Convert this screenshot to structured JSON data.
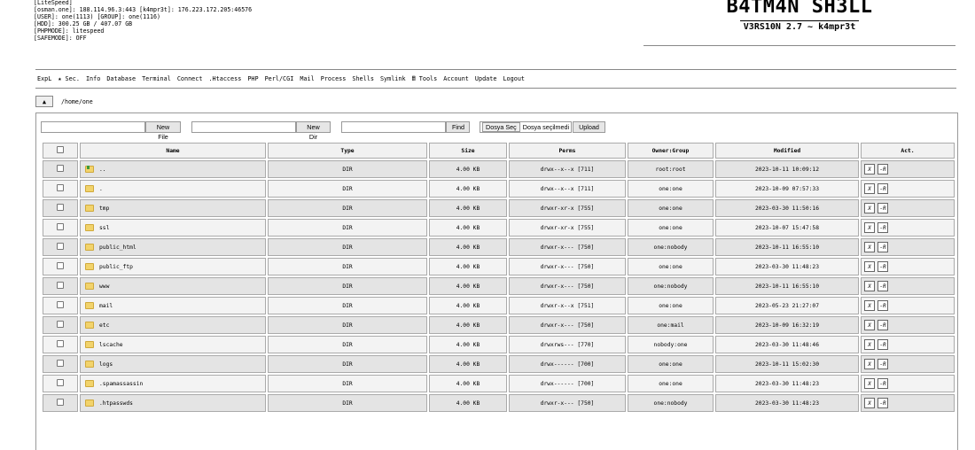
{
  "server_info": {
    "lines": [
      "[LiteSpeed]",
      "[osman.one]: 188.114.96.3:443 [k4mpr3t]: 176.223.172.205:46576",
      "[USER]: one(1113) [GROUP]: one(1116)",
      "[HDD]: 300.25 GB / 407.07 GB",
      "[PHPMODE]: litespeed",
      "[SAFEMODE]: OFF"
    ]
  },
  "brand": {
    "title": "B4TM4N SH3LL",
    "subtitle": "V3RS10N 2.7 ~ k4mpr3t"
  },
  "menu": [
    "ExpL",
    "★ Sec.",
    "Info",
    "Database",
    "Terminal",
    "Connect",
    ".Htaccess",
    "PHP",
    "Perl/CGI",
    "Mail",
    "Process",
    "Shells",
    "Symlink",
    "🖩 Tools",
    "Account",
    "Update",
    "Logout"
  ],
  "path": {
    "up_icon": "▲",
    "current": "/home/one"
  },
  "controls": {
    "new_file": "New File",
    "new_dir": "New Dir",
    "find": "Find",
    "choose_file": "Dosya Seç",
    "no_file": "Dosya seçilmedi",
    "upload": "Upload"
  },
  "table": {
    "headers": [
      "Name",
      "Type",
      "Size",
      "Perms",
      "Owner:Group",
      "Modified",
      "Act."
    ],
    "rows": [
      {
        "name": "..",
        "type": "DIR",
        "size": "4.00 KB",
        "perms": "drwx--x--x [711]",
        "owner": "root:root",
        "modified": "2023-10-11 10:09:12",
        "up": true
      },
      {
        "name": ".",
        "type": "DIR",
        "size": "4.00 KB",
        "perms": "drwx--x--x [711]",
        "owner": "one:one",
        "modified": "2023-10-09 07:57:33"
      },
      {
        "name": "tmp",
        "type": "DIR",
        "size": "4.00 KB",
        "perms": "drwxr-xr-x [755]",
        "owner": "one:one",
        "modified": "2023-03-30 11:50:16"
      },
      {
        "name": "ssl",
        "type": "DIR",
        "size": "4.00 KB",
        "perms": "drwxr-xr-x [755]",
        "owner": "one:one",
        "modified": "2023-10-07 15:47:58"
      },
      {
        "name": "public_html",
        "type": "DIR",
        "size": "4.00 KB",
        "perms": "drwxr-x--- [750]",
        "owner": "one:nobody",
        "modified": "2023-10-11 16:55:10"
      },
      {
        "name": "public_ftp",
        "type": "DIR",
        "size": "4.00 KB",
        "perms": "drwxr-x--- [750]",
        "owner": "one:one",
        "modified": "2023-03-30 11:48:23"
      },
      {
        "name": "www",
        "type": "DIR",
        "size": "4.00 KB",
        "perms": "drwxr-x--- [750]",
        "owner": "one:nobody",
        "modified": "2023-10-11 16:55:10"
      },
      {
        "name": "mail",
        "type": "DIR",
        "size": "4.00 KB",
        "perms": "drwxr-x--x [751]",
        "owner": "one:one",
        "modified": "2023-05-23 21:27:07"
      },
      {
        "name": "etc",
        "type": "DIR",
        "size": "4.00 KB",
        "perms": "drwxr-x--- [750]",
        "owner": "one:mail",
        "modified": "2023-10-09 16:32:19"
      },
      {
        "name": "lscache",
        "type": "DIR",
        "size": "4.00 KB",
        "perms": "drwxrws--- [770]",
        "owner": "nobody:one",
        "modified": "2023-03-30 11:48:46"
      },
      {
        "name": "logs",
        "type": "DIR",
        "size": "4.00 KB",
        "perms": "drwx------ [700]",
        "owner": "one:one",
        "modified": "2023-10-11 15:02:30"
      },
      {
        "name": ".spamassassin",
        "type": "DIR",
        "size": "4.00 KB",
        "perms": "drwx------ [700]",
        "owner": "one:one",
        "modified": "2023-03-30 11:48:23"
      },
      {
        "name": ".htpasswds",
        "type": "DIR",
        "size": "4.00 KB",
        "perms": "drwxr-x--- [750]",
        "owner": "one:nobody",
        "modified": "2023-03-30 11:48:23"
      }
    ],
    "act_labels": [
      "X",
      "-R"
    ]
  }
}
